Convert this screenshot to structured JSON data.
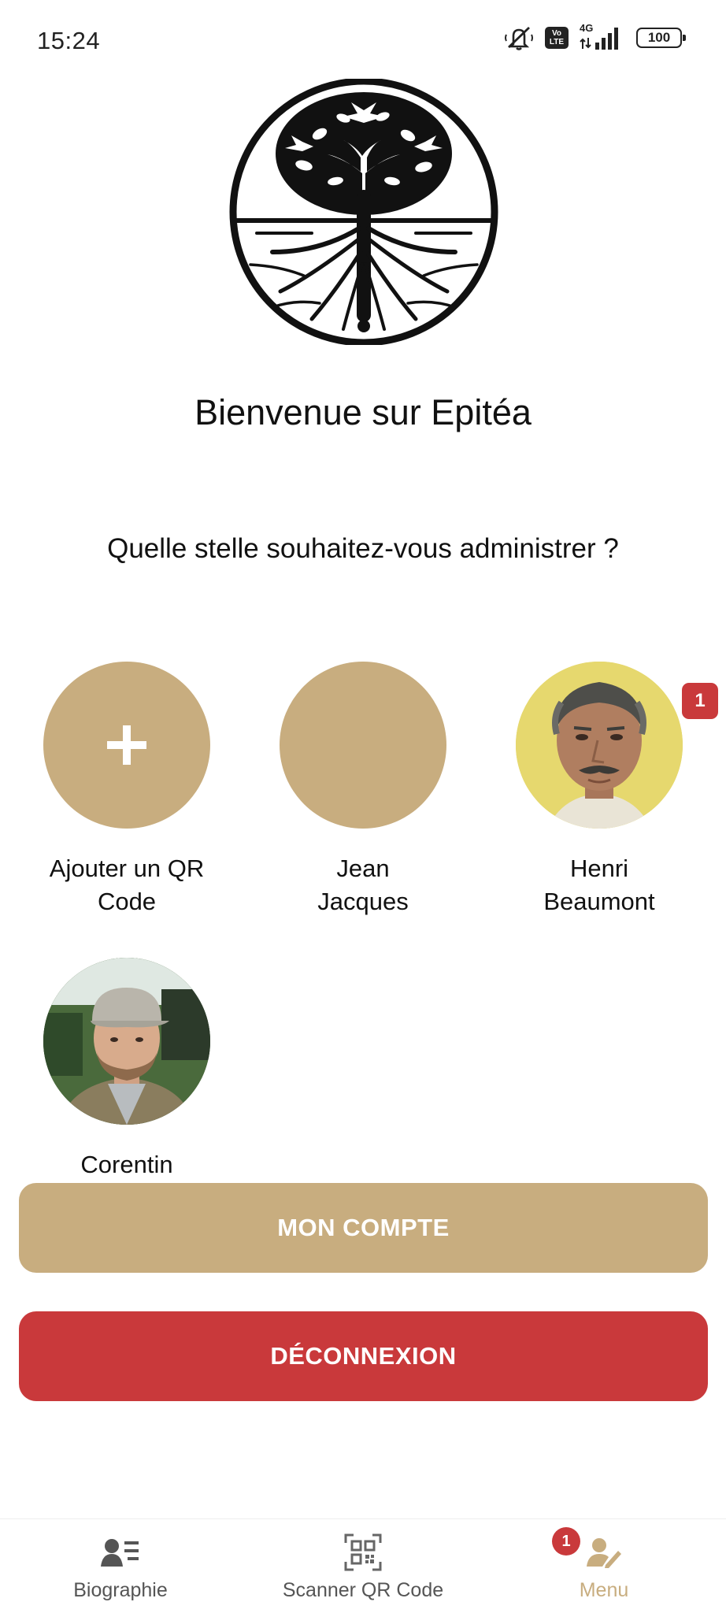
{
  "status_bar": {
    "time": "15:24",
    "network": "4G",
    "volte": "Vo LTE",
    "battery": "100"
  },
  "app": {
    "name": "Epitéa",
    "logo_icon": "tree-of-life-logo"
  },
  "welcome": {
    "title": "Bienvenue sur Epitéa",
    "question": "Quelle stelle souhaitez-vous administrer ?"
  },
  "stelles": [
    {
      "label": "Ajouter un QR Code",
      "icon": "plus-icon"
    },
    {
      "label": "Jean Jacques"
    },
    {
      "label": "Henri Beaumont",
      "badge": "1",
      "avatar": "elderly-man-photo"
    },
    {
      "label": "Corentin",
      "avatar": "man-with-cap-photo"
    }
  ],
  "buttons": {
    "account": "MON COMPTE",
    "logout": "DÉCONNEXION"
  },
  "bottom_nav": [
    {
      "label": "Biographie",
      "icon": "person-list-icon"
    },
    {
      "label": "Scanner QR Code",
      "icon": "qr-code-icon"
    },
    {
      "label": "Menu",
      "icon": "person-edit-icon",
      "badge": "1",
      "active": true
    }
  ],
  "colors": {
    "accent": "#c8ad7f",
    "danger": "#c9393b",
    "text": "#111111"
  }
}
